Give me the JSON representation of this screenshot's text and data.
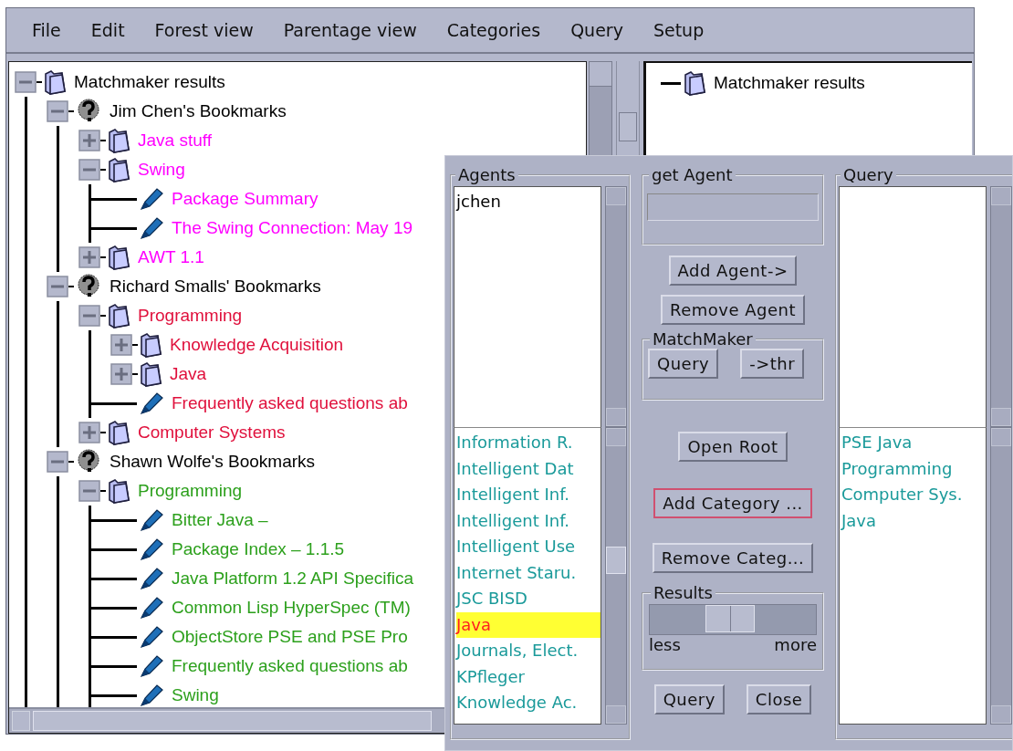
{
  "menu": [
    "File",
    "Edit",
    "Forest view",
    "Parentage view",
    "Categories",
    "Query",
    "Setup"
  ],
  "forest_tree": {
    "nodes": [
      {
        "kind": "folder",
        "label": "Matchmaker results",
        "color": "#000000",
        "expanded": true,
        "children": [
          {
            "kind": "agent",
            "label": "Jim Chen's Bookmarks",
            "color": "#000000",
            "expanded": true,
            "children": [
              {
                "kind": "folder",
                "label": "Java stuff",
                "color": "#ff00ff",
                "expanded": false
              },
              {
                "kind": "folder",
                "label": "Swing",
                "color": "#ff00ff",
                "expanded": true,
                "children": [
                  {
                    "kind": "bookmark",
                    "label": "Package Summary",
                    "color": "#ff00ff"
                  },
                  {
                    "kind": "bookmark",
                    "label": "The Swing Connection: May 19",
                    "color": "#ff00ff"
                  }
                ]
              },
              {
                "kind": "folder",
                "label": "AWT 1.1",
                "color": "#ff00ff",
                "expanded": false
              }
            ]
          },
          {
            "kind": "agent",
            "label": "Richard Smalls' Bookmarks",
            "color": "#000000",
            "expanded": true,
            "children": [
              {
                "kind": "folder",
                "label": "Programming",
                "color": "#e0103c",
                "expanded": true,
                "children": [
                  {
                    "kind": "folder",
                    "label": "Knowledge Acquisition",
                    "color": "#e0103c",
                    "expanded": false
                  },
                  {
                    "kind": "folder",
                    "label": "Java",
                    "color": "#e0103c",
                    "expanded": false
                  },
                  {
                    "kind": "bookmark",
                    "label": "Frequently asked questions ab",
                    "color": "#e0103c"
                  }
                ]
              },
              {
                "kind": "folder",
                "label": "Computer Systems",
                "color": "#e0103c",
                "expanded": false
              }
            ]
          },
          {
            "kind": "agent",
            "label": "Shawn Wolfe's Bookmarks",
            "color": "#000000",
            "expanded": true,
            "children": [
              {
                "kind": "folder",
                "label": "Programming",
                "color": "#2ca01c",
                "expanded": true,
                "children": [
                  {
                    "kind": "bookmark",
                    "label": "Bitter Java –",
                    "color": "#2ca01c"
                  },
                  {
                    "kind": "bookmark",
                    "label": "Package Index – 1.1.5",
                    "color": "#2ca01c"
                  },
                  {
                    "kind": "bookmark",
                    "label": "Java Platform 1.2 API Specifica",
                    "color": "#2ca01c"
                  },
                  {
                    "kind": "bookmark",
                    "label": "Common Lisp HyperSpec (TM)",
                    "color": "#2ca01c"
                  },
                  {
                    "kind": "bookmark",
                    "label": "ObjectStore PSE and PSE Pro",
                    "color": "#2ca01c"
                  },
                  {
                    "kind": "bookmark",
                    "label": "Frequently asked questions ab",
                    "color": "#2ca01c"
                  },
                  {
                    "kind": "bookmark",
                    "label": "Swing",
                    "color": "#2ca01c"
                  }
                ]
              }
            ]
          }
        ]
      }
    ]
  },
  "parentage_tree": {
    "root": {
      "label": "Matchmaker results"
    }
  },
  "dialog": {
    "agents": {
      "title": "Agents",
      "items": [
        "jchen"
      ],
      "categories": [
        {
          "label": "Information R.",
          "selected": false
        },
        {
          "label": "Intelligent Dat",
          "selected": false
        },
        {
          "label": "Intelligent Inf.",
          "selected": false
        },
        {
          "label": "Intelligent Inf.",
          "selected": false
        },
        {
          "label": "Intelligent Use",
          "selected": false
        },
        {
          "label": "Internet Staru.",
          "selected": false
        },
        {
          "label": "JSC BISD",
          "selected": false
        },
        {
          "label": "Java",
          "selected": true
        },
        {
          "label": "Journals, Elect.",
          "selected": false
        },
        {
          "label": "KPfleger",
          "selected": false
        },
        {
          "label": "Knowledge Ac.",
          "selected": false
        }
      ]
    },
    "get_agent": {
      "title": "get Agent"
    },
    "add_agent": "Add Agent->",
    "remove_agent": "Remove Agent",
    "matchmaker": {
      "title": "MatchMaker",
      "buttons": [
        "Query",
        "->thr"
      ]
    },
    "open_root": "Open Root",
    "add_category": {
      "label": "Add Category ...",
      "focused": true
    },
    "remove_category": "Remove Categ...",
    "results": {
      "title": "Results",
      "level": 0.48,
      "min_label": "less",
      "max_label": "more"
    },
    "footer_buttons": [
      "Query",
      "Close"
    ],
    "query": {
      "title": "Query",
      "categories": [
        "PSE Java",
        "Programming",
        "Computer Sys.",
        "Java"
      ]
    }
  }
}
